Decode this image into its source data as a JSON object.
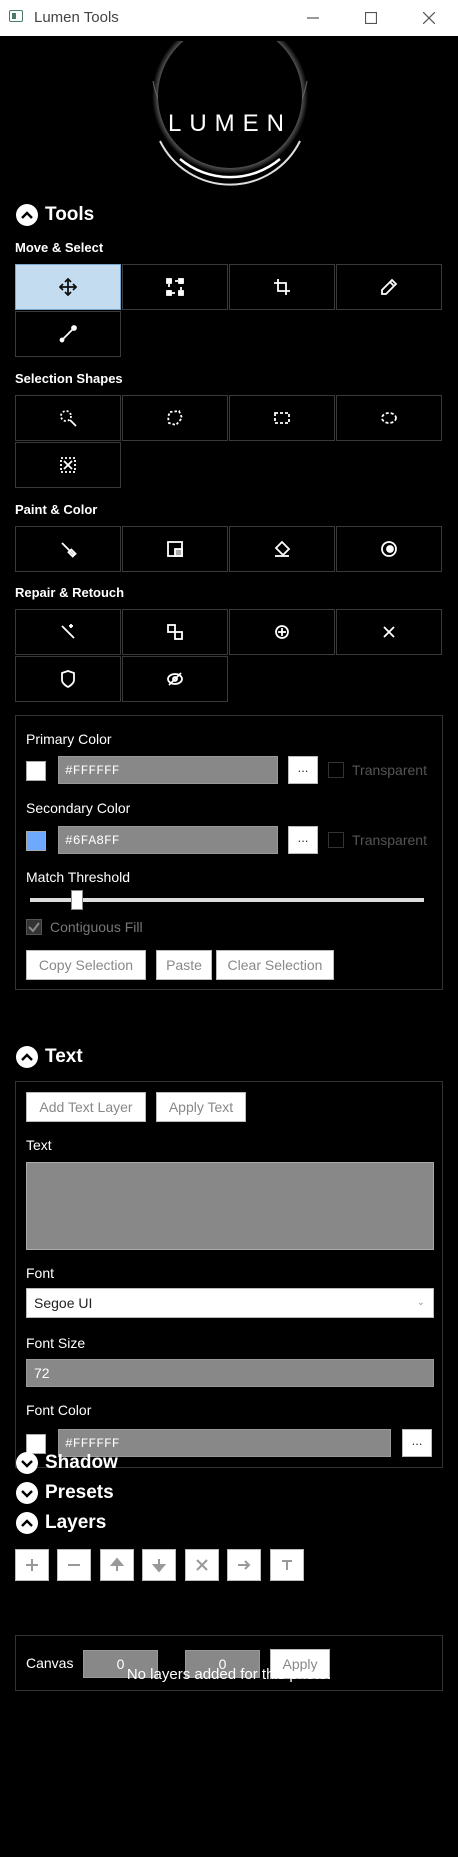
{
  "window": {
    "title": "Lumen Tools"
  },
  "logo": {
    "text": "LUMEN"
  },
  "tools": {
    "title": "Tools",
    "groups": {
      "move_select": "Move & Select",
      "selection_shapes": "Selection Shapes",
      "paint_color": "Paint & Color",
      "repair_retouch": "Repair & Retouch"
    }
  },
  "colors": {
    "primary_label": "Primary Color",
    "primary_value": "#FFFFFF",
    "primary_swatch": "#FFFFFF",
    "secondary_label": "Secondary Color",
    "secondary_value": "#6FA8FF",
    "secondary_swatch": "#6FA8FF",
    "dots": "...",
    "transparent_label": "Transparent",
    "threshold_label": "Match Threshold",
    "threshold_value": 0.12,
    "contiguous_label": "Contiguous Fill",
    "copy_selection": "Copy Selection",
    "paste": "Paste",
    "clear_selection": "Clear Selection"
  },
  "text": {
    "title": "Text",
    "add_text_layer": "Add Text Layer",
    "apply_text": "Apply Text",
    "text_label": "Text",
    "text_value": "",
    "font_label": "Font",
    "font_value": "Segoe UI",
    "font_size_label": "Font Size",
    "font_size_value": "72",
    "font_color_label": "Font Color",
    "font_color_value": "#FFFFFF",
    "font_color_swatch": "#FFFFFF",
    "dots": "..."
  },
  "collapsed_sections": {
    "shadow": "Shadow",
    "presets": "Presets"
  },
  "layers": {
    "title": "Layers",
    "canvas_label": "Canvas",
    "canvas_x": "0",
    "canvas_y": "0",
    "apply": "Apply",
    "empty_message": "No layers added for this photo.",
    "buttons": [
      "add-icon",
      "remove-icon",
      "move-up-icon",
      "move-down-icon",
      "delete-icon",
      "arrow-right-icon",
      "text-icon"
    ]
  }
}
